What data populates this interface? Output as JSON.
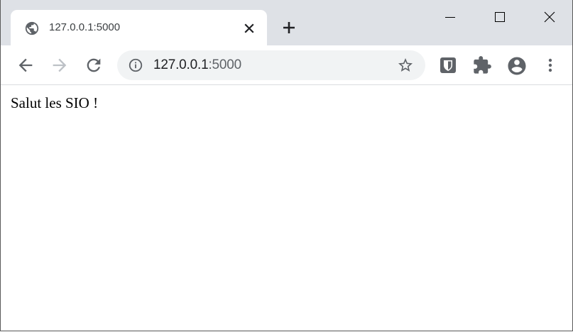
{
  "tab": {
    "title": "127.0.0.1:5000",
    "favicon": "globe-icon",
    "close_icon": "close-icon"
  },
  "new_tab_icon": "plus-icon",
  "window_controls": {
    "minimize_icon": "minimize-icon",
    "maximize_icon": "maximize-icon",
    "close_icon": "close-icon"
  },
  "toolbar": {
    "back_icon": "arrow-left-icon",
    "forward_icon": "arrow-right-icon",
    "reload_icon": "reload-icon",
    "extensions": [
      "bitwarden-shield-icon",
      "puzzle-piece-icon"
    ],
    "profile_icon": "account-circle-icon",
    "menu_icon": "kebab-menu-icon"
  },
  "omnibox": {
    "info_icon": "info-icon",
    "url_host": "127.0.0.1",
    "url_port": ":5000",
    "bookmark_icon": "star-icon"
  },
  "page": {
    "message": "Salut les SIO !"
  },
  "colors": {
    "tabstrip": "#dee1e6",
    "omnibox_bg": "#f1f3f4",
    "icon": "#5f6368",
    "icon_dark": "#3c4043",
    "windows_accent": "#0078d7"
  }
}
